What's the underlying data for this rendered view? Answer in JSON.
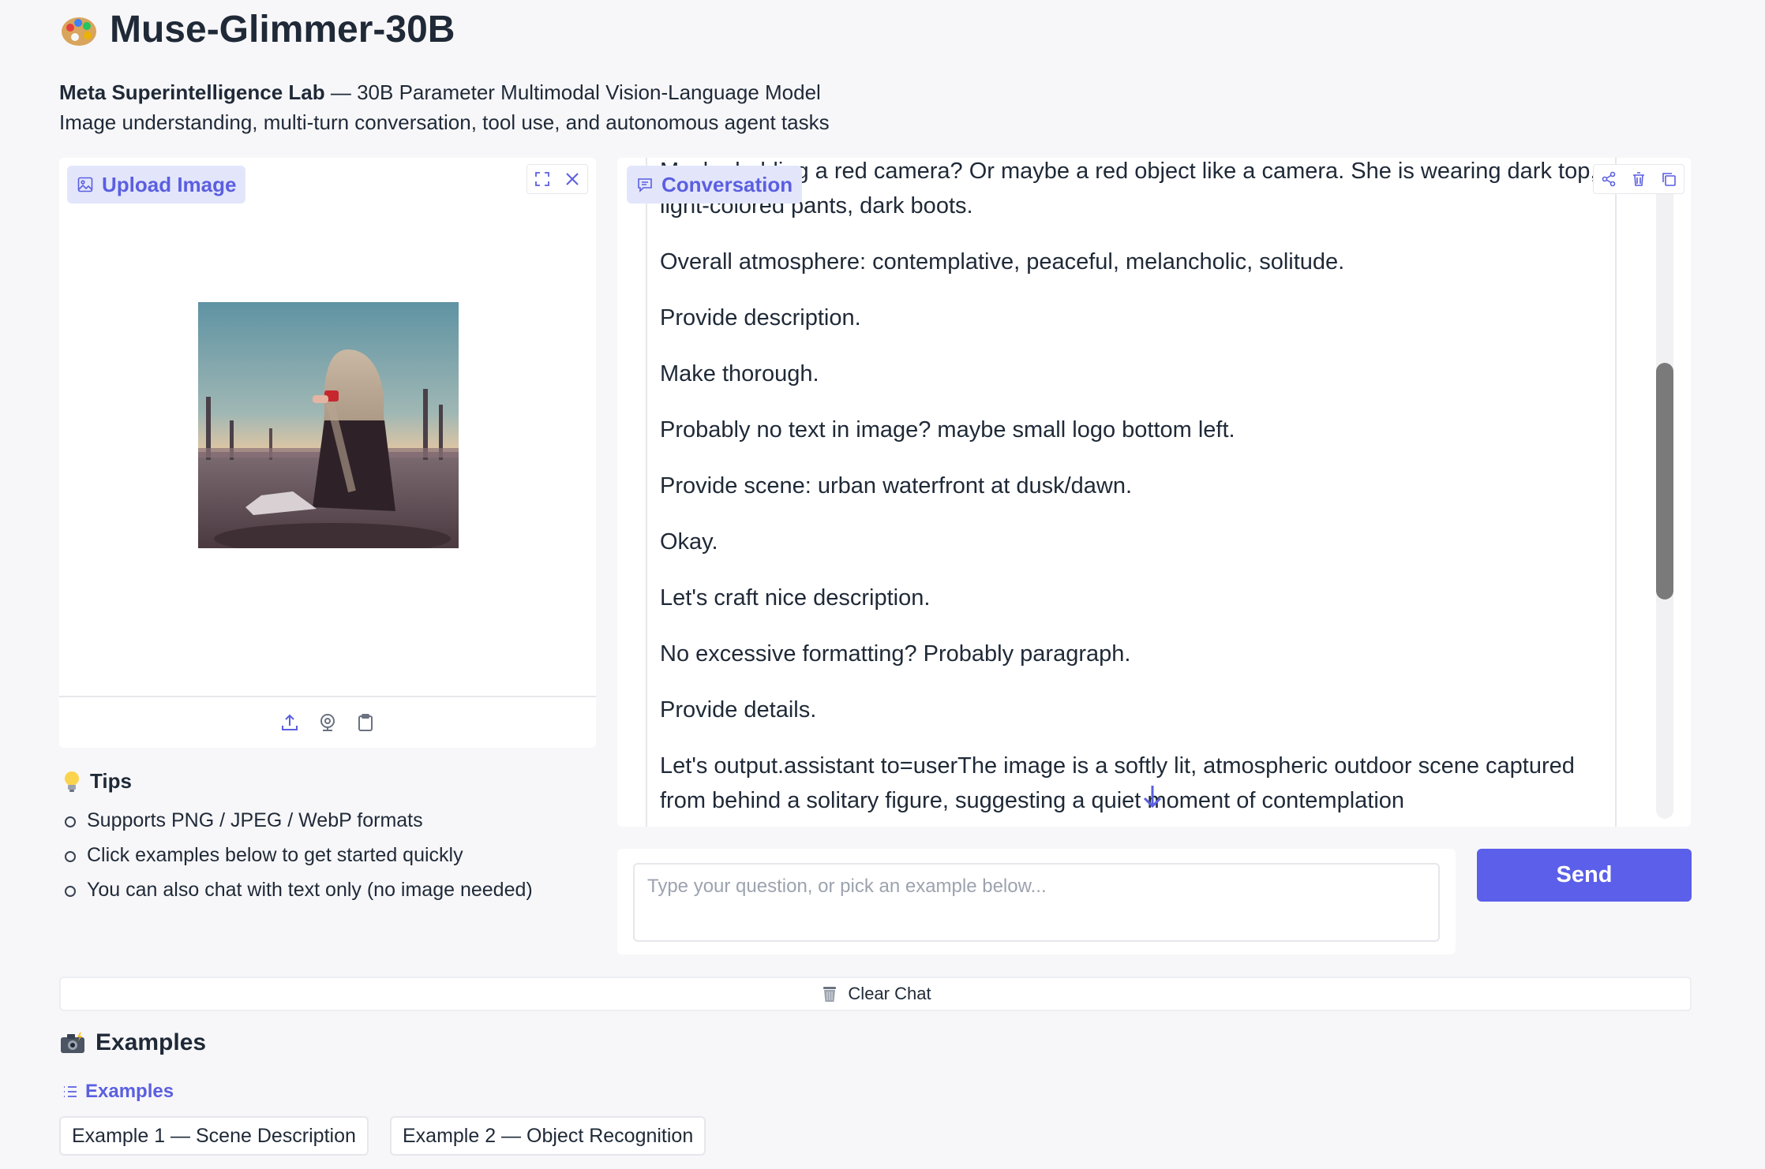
{
  "header": {
    "title": "Muse-Glimmer-30B",
    "org": "Meta Superintelligence Lab",
    "tagline": " — 30B Parameter Multimodal Vision-Language Model",
    "description": "Image understanding, multi-turn conversation, tool use, and autonomous agent tasks"
  },
  "upload": {
    "label": "Upload Image"
  },
  "tips": {
    "title": "Tips",
    "items": [
      "Supports PNG / JPEG / WebP formats",
      "Click examples below to get started quickly",
      "You can also chat with text only (no image needed)"
    ]
  },
  "conversation": {
    "label": "Conversation",
    "paragraphs": [
      "Maybe holding a red camera? Or maybe a red object like a camera. She is wearing dark top, light-colored pants, dark boots.",
      "Overall atmosphere: contemplative, peaceful, melancholic, solitude.",
      "Provide description.",
      "Make thorough.",
      "Probably no text in image? maybe small logo bottom left.",
      "Provide scene: urban waterfront at dusk/dawn.",
      "Okay.",
      "Let's craft nice description.",
      "No excessive formatting? Probably paragraph.",
      "Provide details.",
      "Let's output.assistant to=userThe image is a softly lit, atmospheric outdoor scene captured from behind a solitary figure, suggesting a quiet moment of contemplation"
    ]
  },
  "input": {
    "placeholder": "Type your question, or pick an example below..."
  },
  "send_label": "Send",
  "clear_label": "Clear Chat",
  "examples": {
    "title": "Examples",
    "sub_label": "Examples",
    "items": [
      "Example 1 — Scene Description",
      "Example 2 — Object Recognition"
    ]
  },
  "colors": {
    "accent": "#5b5fe9",
    "chip_bg": "#e3e6fb",
    "background": "#f7f7f9"
  }
}
